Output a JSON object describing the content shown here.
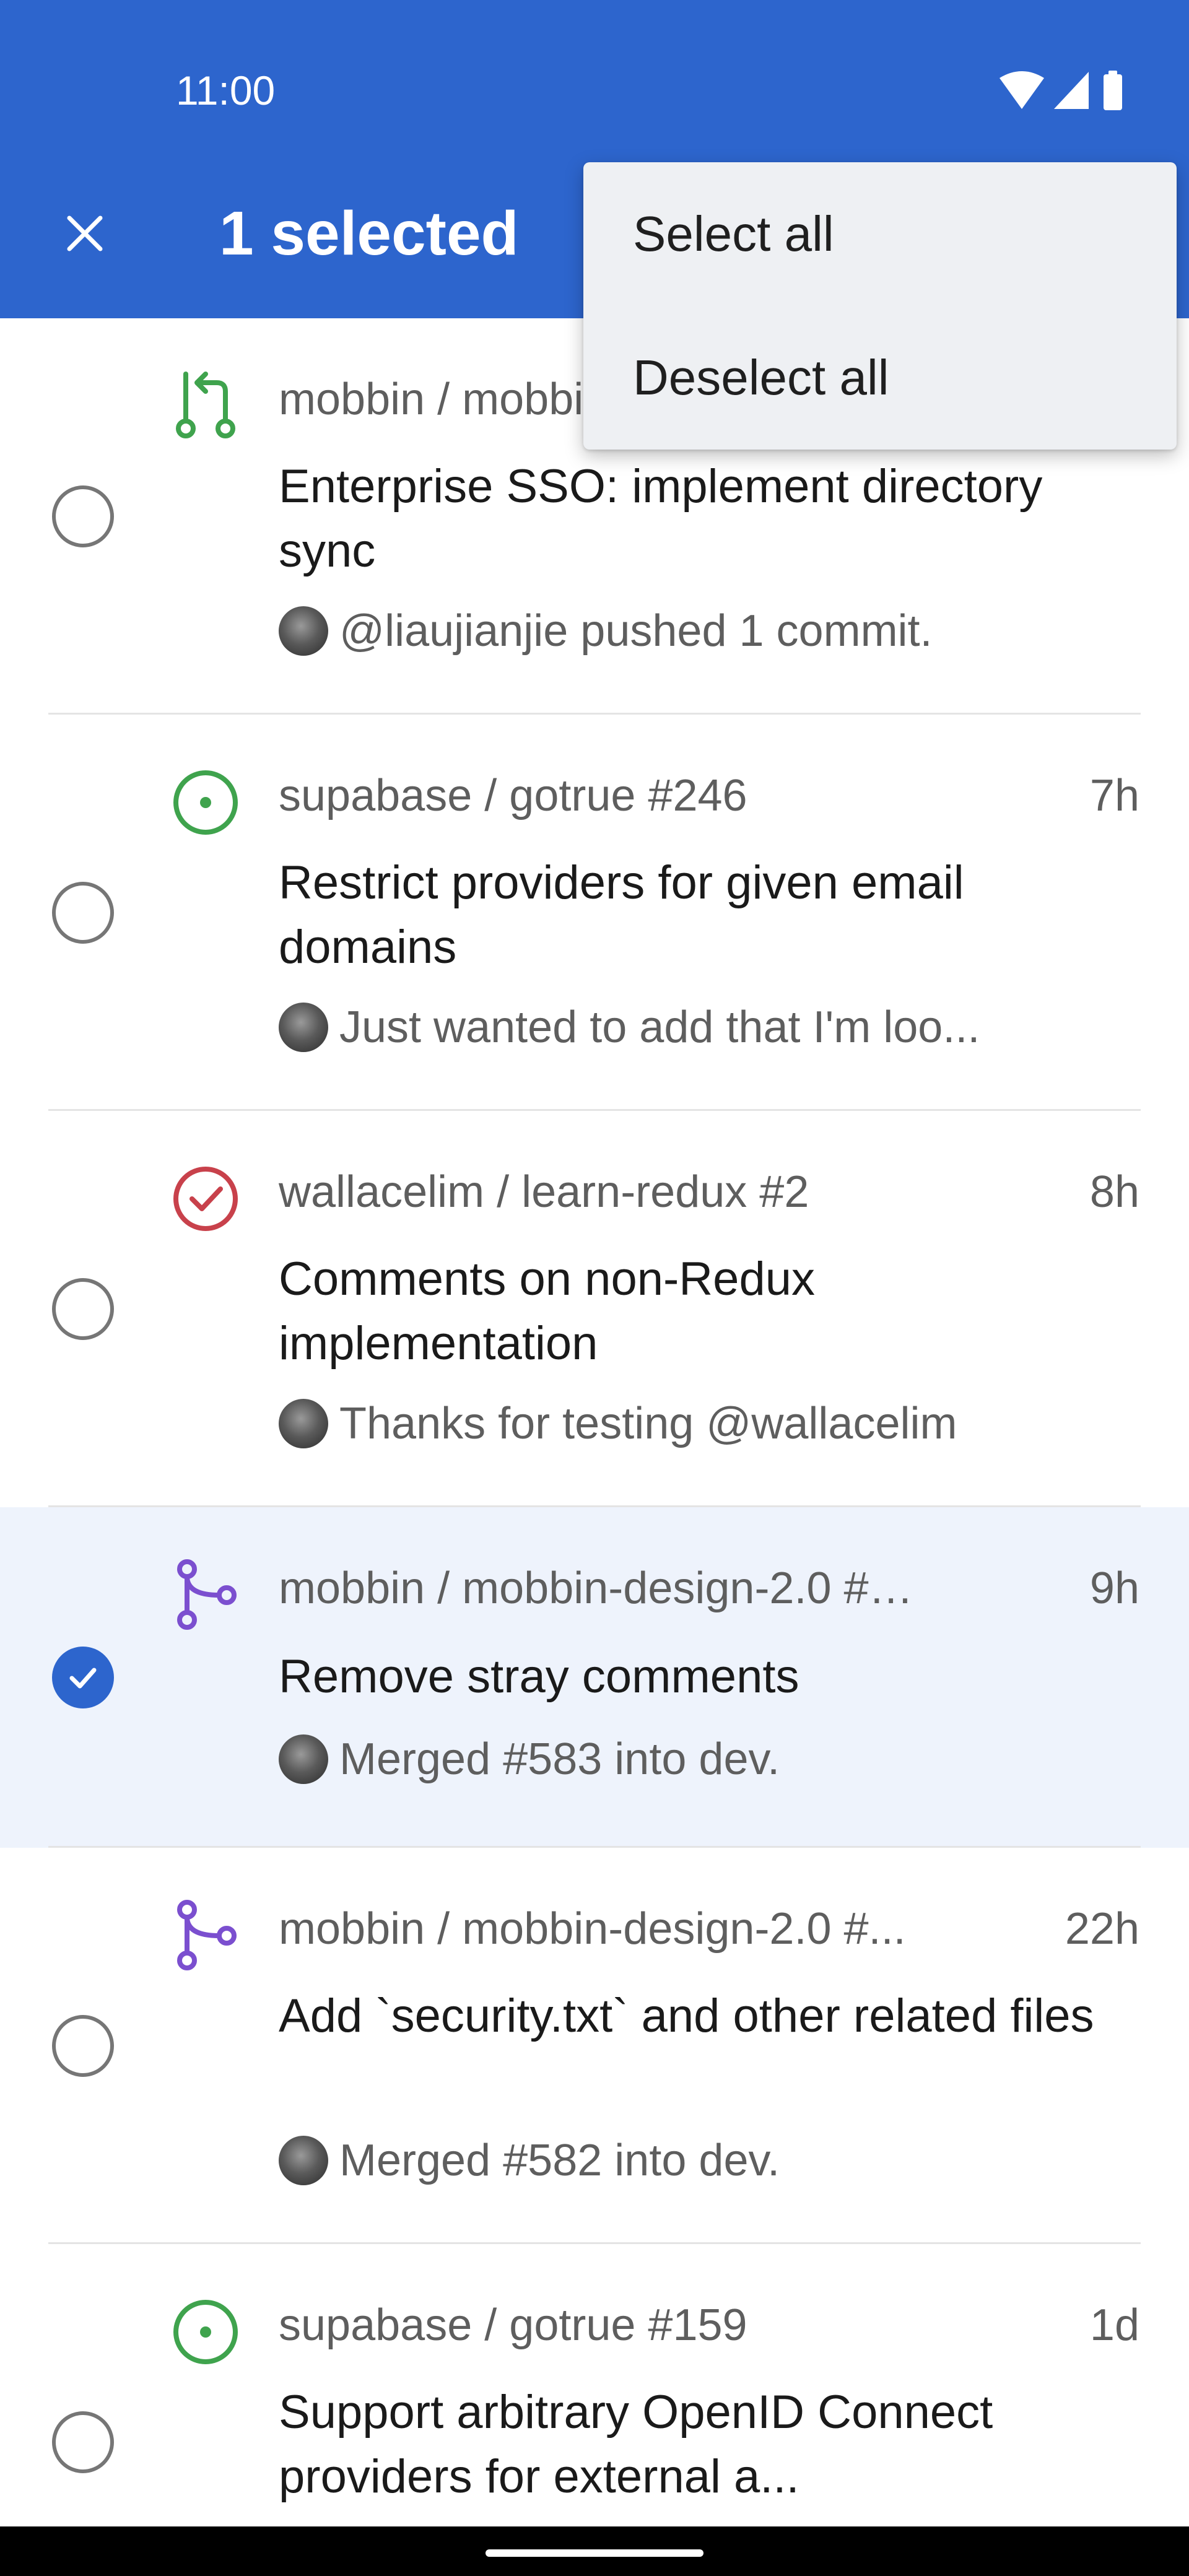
{
  "status_bar": {
    "time": "11:00"
  },
  "app_bar": {
    "title": "1 selected"
  },
  "menu": {
    "items": [
      "Select all",
      "Deselect all"
    ]
  },
  "notifications": [
    {
      "type": "pull-request",
      "repo": "mobbin / mobbin-design-2.0",
      "time": "",
      "title": "Enterprise SSO: implement directory sync",
      "snippet": "@liaujianjie pushed 1 commit.",
      "selected": false
    },
    {
      "type": "issue-open",
      "repo": "supabase / gotrue #246",
      "time": "7h",
      "title": "Restrict providers for given email domains",
      "snippet": "Just wanted to add that I'm loo...",
      "selected": false
    },
    {
      "type": "issue-closed",
      "repo": "wallacelim / learn-redux #2",
      "time": "8h",
      "title": "Comments on non-Redux implementation",
      "snippet": "Thanks for testing @wallacelim",
      "selected": false
    },
    {
      "type": "merged",
      "repo": "mobbin / mobbin-design-2.0 #5...",
      "time": "9h",
      "title": "Remove stray comments",
      "snippet": "Merged #583 into dev.",
      "selected": true
    },
    {
      "type": "merged",
      "repo": "mobbin / mobbin-design-2.0 #...",
      "time": "22h",
      "title": "Add `security.txt` and other related files",
      "snippet": "Merged #582 into dev.",
      "selected": false
    },
    {
      "type": "issue-open",
      "repo": "supabase / gotrue #159",
      "time": "1d",
      "title": "Support arbitrary OpenID Connect providers for external a...",
      "snippet": "",
      "selected": false
    }
  ],
  "colors": {
    "app_bar": "#2d65cd",
    "open": "#3fa34d",
    "closed": "#c8414b",
    "merged": "#7b4fcf",
    "selected_row": "#eef3fc"
  },
  "icons": {
    "close": "close-icon",
    "wifi": "wifi-icon",
    "signal": "signal-icon",
    "battery": "battery-icon",
    "pull_request": "pull-request-icon",
    "issue_open": "issue-open-icon",
    "issue_closed": "issue-closed-icon",
    "merged": "merged-icon",
    "check": "check-icon"
  }
}
